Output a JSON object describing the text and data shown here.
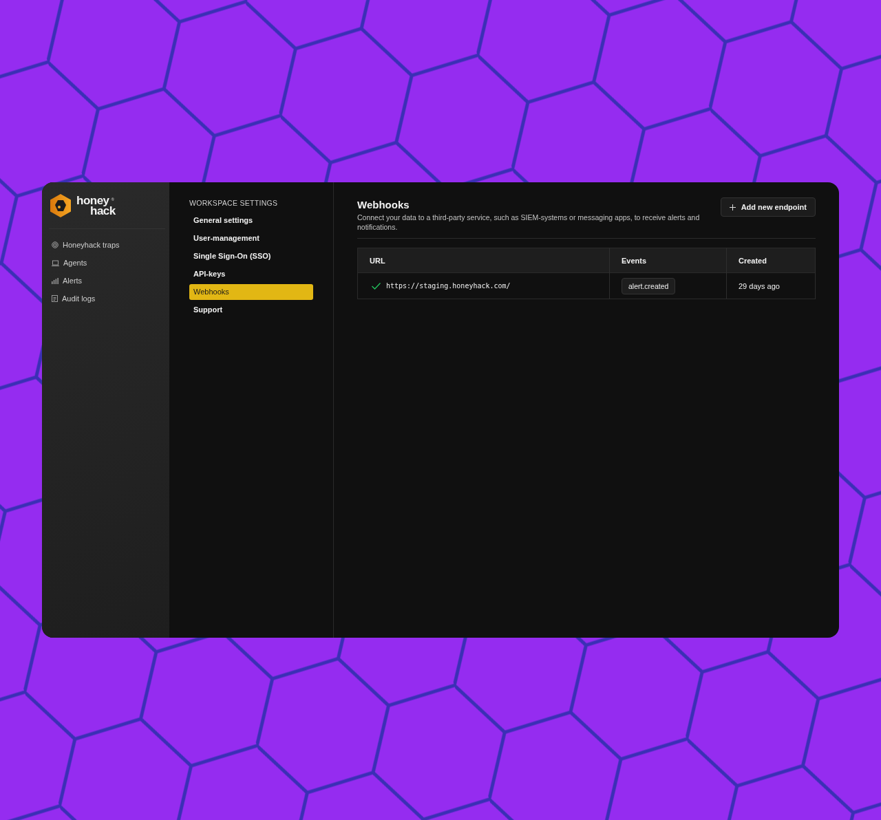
{
  "logo": {
    "line_1": "honey",
    "line_2": "hack",
    "mark": "®"
  },
  "sidebar": {
    "items": [
      {
        "label": "Honeyhack traps",
        "kind": "traps",
        "selected": false
      },
      {
        "label": "Agents",
        "kind": "agents",
        "selected": false
      },
      {
        "label": "Alerts",
        "kind": "alerts",
        "selected": false
      },
      {
        "label": "Audit logs",
        "kind": "logs",
        "selected": false
      }
    ]
  },
  "settings_nav": {
    "heading": "WORKSPACE SETTINGS",
    "items": [
      {
        "label": "General settings",
        "selected": false
      },
      {
        "label": "User-management",
        "selected": false
      },
      {
        "label": "Single Sign-On (SSO)",
        "selected": false
      },
      {
        "label": "API-keys",
        "selected": false
      },
      {
        "label": "Webhooks",
        "selected": true
      },
      {
        "label": "Support",
        "selected": false
      }
    ]
  },
  "main": {
    "title": "Webhooks",
    "description": "Connect your data to a third-party service, such as SIEM-systems or messaging apps, to receive alerts and notifications.",
    "add_button": "Add new endpoint",
    "table": {
      "columns": [
        "URL",
        "Events",
        "Created"
      ],
      "rows": [
        {
          "active": true,
          "url": "https://staging.honeyhack.com/",
          "events": [
            "alert.created"
          ],
          "created": "29 days ago"
        }
      ]
    }
  }
}
